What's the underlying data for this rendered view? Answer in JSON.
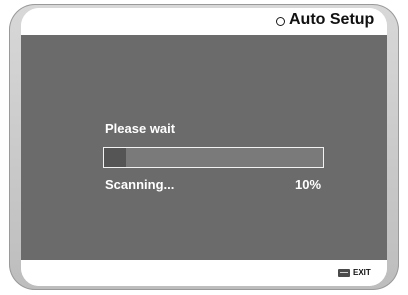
{
  "header": {
    "title": "Auto Setup",
    "icon": "circle-icon"
  },
  "main": {
    "wait_text": "Please wait",
    "status_text": "Scanning...",
    "progress_label": "10%",
    "progress_value": 0.1
  },
  "footer": {
    "exit_label": "EXIT",
    "exit_icon": "exit-button-icon"
  },
  "colors": {
    "background": "#6b6b6b",
    "text": "#ffffff",
    "progress_fill": "#555555"
  }
}
